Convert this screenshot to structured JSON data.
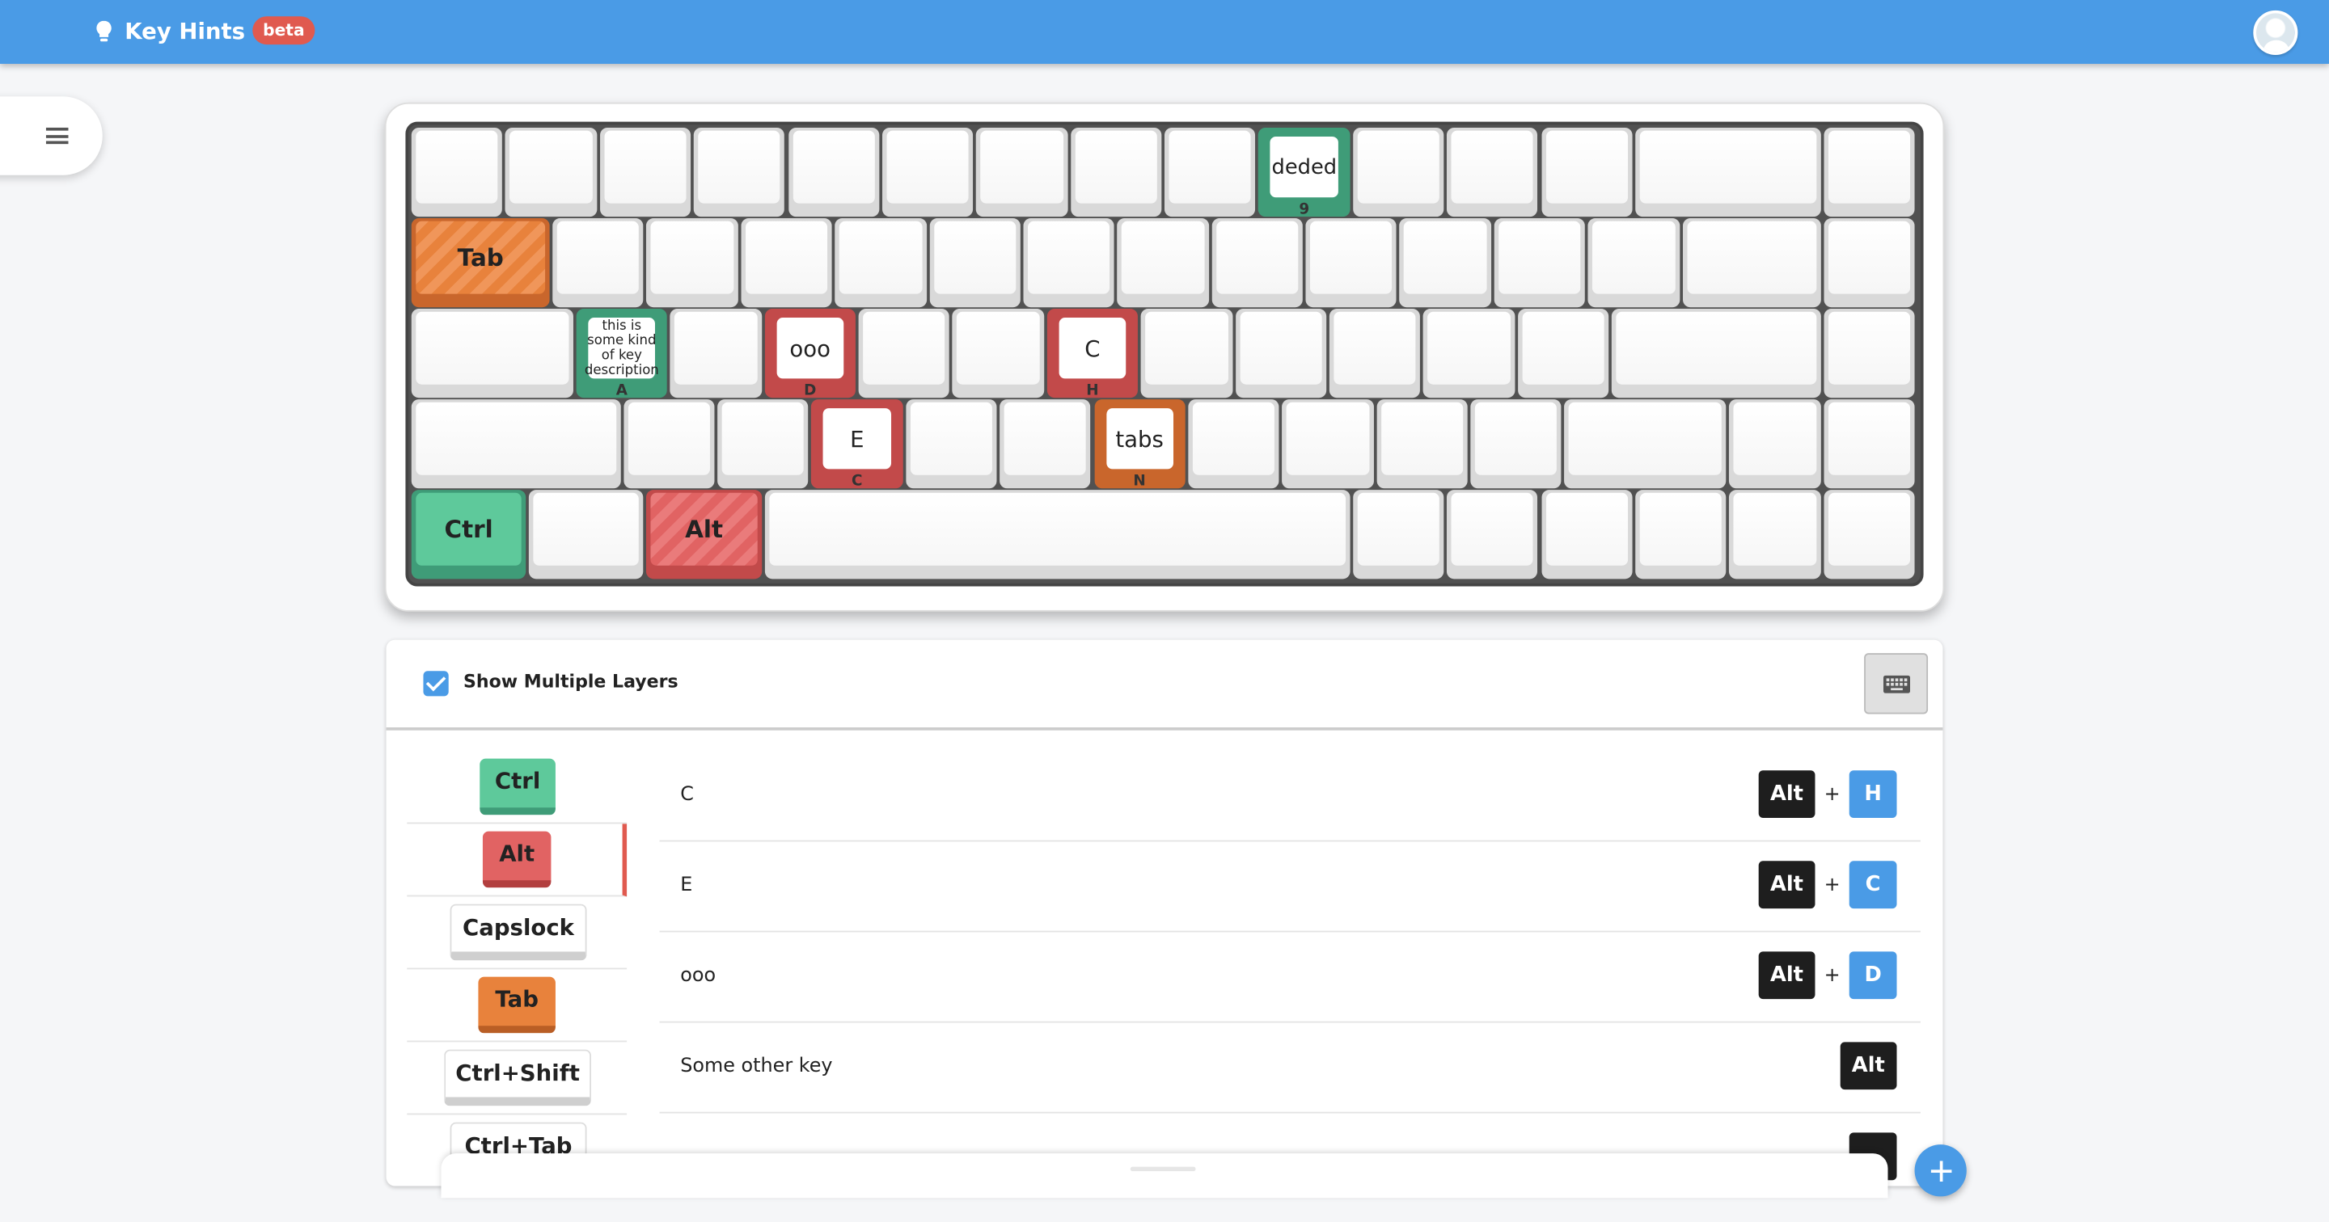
{
  "app": {
    "title": "Key Hints",
    "badge": "beta"
  },
  "keyboard": {
    "labels": {
      "deded": "deded",
      "deded_sub": "9",
      "tab": "Tab",
      "desc": "this is some kind of key description",
      "desc_sub": "A",
      "ooo": "ooo",
      "ooo_sub": "D",
      "c": "C",
      "c_sub": "H",
      "e": "E",
      "e_sub": "C",
      "tabs": "tabs",
      "tabs_sub": "N",
      "ctrl": "Ctrl",
      "alt": "Alt"
    }
  },
  "panel": {
    "show_multiple_layers_label": "Show Multiple Layers",
    "show_multiple_layers_checked": true,
    "layers": [
      {
        "label": "Ctrl",
        "color": "green"
      },
      {
        "label": "Alt",
        "color": "red"
      },
      {
        "label": "Capslock",
        "color": "white"
      },
      {
        "label": "Tab",
        "color": "orange"
      },
      {
        "label": "Ctrl+Shift",
        "color": "white"
      },
      {
        "label": "Ctrl+Tab",
        "color": "white"
      }
    ],
    "shortcuts": [
      {
        "label": "C",
        "modifier": "Alt",
        "plus": "+",
        "key": "H"
      },
      {
        "label": "E",
        "modifier": "Alt",
        "plus": "+",
        "key": "C"
      },
      {
        "label": "ooo",
        "modifier": "Alt",
        "plus": "+",
        "key": "D"
      },
      {
        "label": "Some other key",
        "modifier": "Alt"
      }
    ]
  },
  "colors": {
    "accent": "#4a9be6",
    "green": "#5ec99b",
    "red": "#e16363",
    "orange": "#e8823c",
    "badge": "#e05a4f"
  },
  "icons": [
    "lightbulb-icon",
    "menu-icon",
    "avatar-icon",
    "keyboard-icon",
    "add-icon"
  ]
}
